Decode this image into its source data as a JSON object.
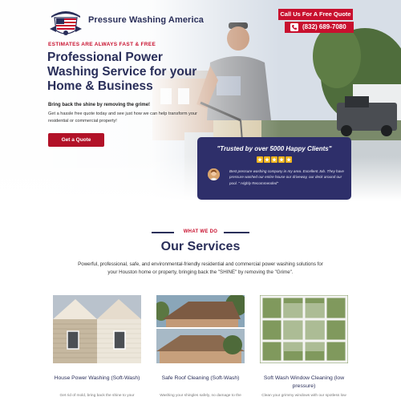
{
  "header": {
    "brand": "Pressure Washing America",
    "call_label": "Call Us For A Free Quote",
    "phone": "(832) 689-7080"
  },
  "hero": {
    "eyebrow": "ESTIMATES ARE ALWAYS FAST & FREE",
    "headline": "Professional Power Washing Service for your Home & Business",
    "sub1": "Bring back the shine by removing the grime!",
    "sub2": "Get a hassle free quote today and see just how we can help transform your residential or commercial property!",
    "cta": "Get a Quote"
  },
  "review": {
    "title": "\"Trusted by over 5000 Happy Clients\"",
    "stars": 5,
    "text": "Best pressure washing company in my area. Excellent Job. They have pressure washed our entire house our driveway, our deck around our pool. \" Highly Recommended\""
  },
  "services": {
    "eyebrow": "WHAT WE DO",
    "title": "Our Services",
    "description": "Powerful, professional, safe, and environmental-friendly residential and commercial power washing solutions for your Houston home or property, bringing back the \"SHINE\" by removing the \"Grime\".",
    "items": [
      {
        "title": "House Power Washing (Soft-Wash)",
        "desc": "Get rid of mold, bring back the shine to your"
      },
      {
        "title": "Safe Roof Cleaning (Soft-Wash)",
        "desc": "Washing your shingles safely, no damage to the"
      },
      {
        "title": "Soft Wash Window Cleaning (low pressure)",
        "desc": "Clean your grimmy windows with our spotless low"
      }
    ]
  },
  "colors": {
    "navy": "#2a2f5a",
    "red": "#c8102e",
    "card": "#2e2f6a",
    "star": "#f3b51b"
  }
}
